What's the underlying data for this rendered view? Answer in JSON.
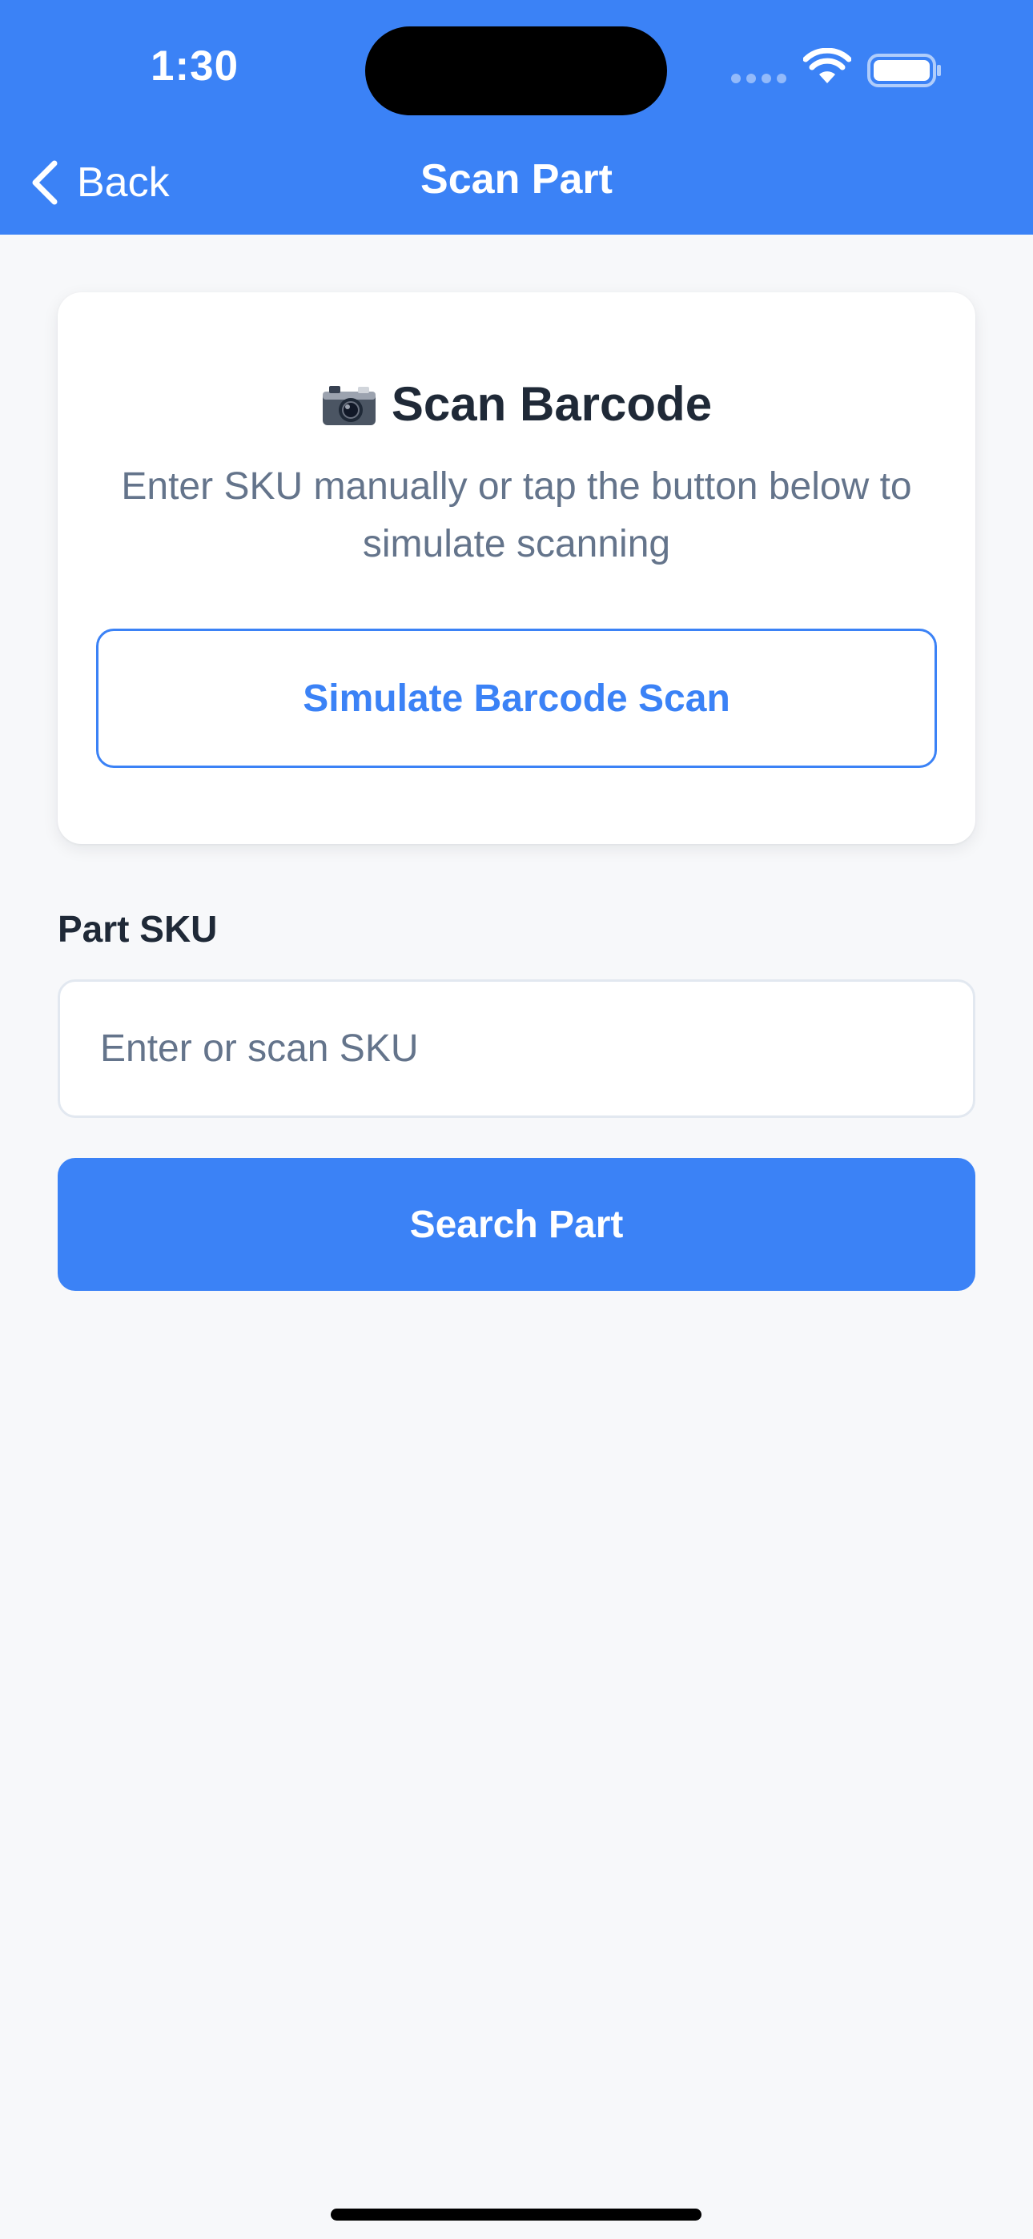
{
  "status_bar": {
    "time": "1:30"
  },
  "nav": {
    "back_label": "Back",
    "title": "Scan Part"
  },
  "scan_card": {
    "icon": "camera-icon",
    "title": "Scan Barcode",
    "subtitle": "Enter SKU manually or tap the button below to simulate scanning",
    "simulate_button_label": "Simulate Barcode Scan"
  },
  "form": {
    "sku_label": "Part SKU",
    "sku_value": "",
    "sku_placeholder": "Enter or scan SKU",
    "search_button_label": "Search Part"
  },
  "colors": {
    "accent": "#3b82f6",
    "background": "#f7f8fa",
    "title_text": "#1f2937",
    "muted_text": "#64748b"
  }
}
